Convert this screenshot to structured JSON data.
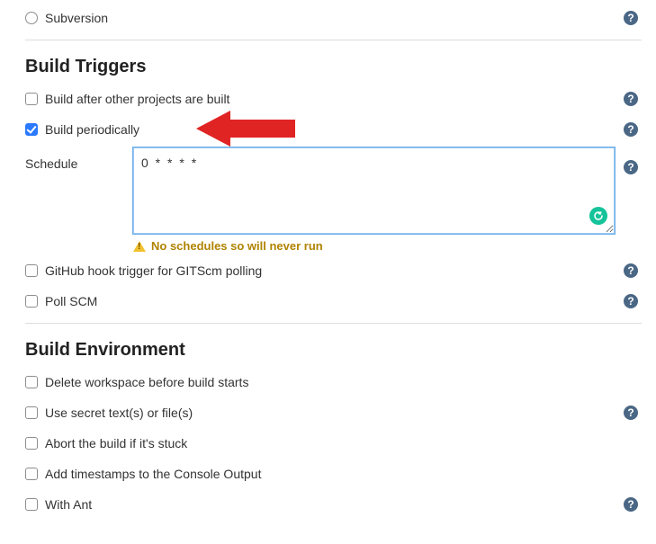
{
  "scm": {
    "subversion_label": "Subversion"
  },
  "triggers": {
    "title": "Build Triggers",
    "build_after_label": "Build after other projects are built",
    "build_periodically_label": "Build periodically",
    "schedule_label": "Schedule",
    "schedule_value": "0 * * * *",
    "schedule_warning": "No schedules so will never run",
    "github_hook_label": "GitHub hook trigger for GITScm polling",
    "poll_scm_label": "Poll SCM"
  },
  "env": {
    "title": "Build Environment",
    "delete_workspace_label": "Delete workspace before build starts",
    "secret_text_label": "Use secret text(s) or file(s)",
    "abort_stuck_label": "Abort the build if it's stuck",
    "timestamps_label": "Add timestamps to the Console Output",
    "with_ant_label": "With Ant"
  },
  "help_glyph": "?"
}
